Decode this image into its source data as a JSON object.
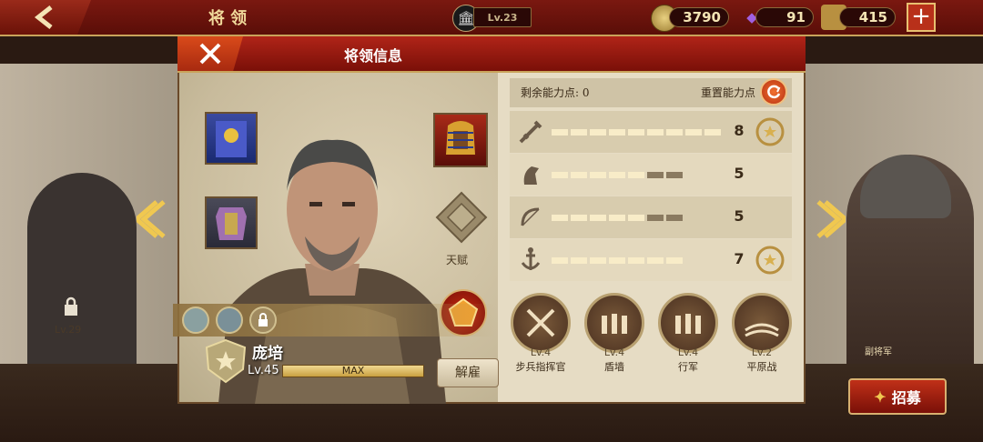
{
  "header": {
    "title": "将 领",
    "hall_level": "Lv.23",
    "resources": {
      "coins": "3790",
      "gems": "91",
      "food": "415"
    }
  },
  "dialog": {
    "title": "将领信息",
    "remaining_points_label": "剩余能力点: 0",
    "reset_label": "重置能力点",
    "talent_label": "天赋",
    "dismiss_label": "解雇",
    "general": {
      "name": "庞培",
      "level": "Lv.45",
      "xp_text": "MAX",
      "xp_fraction": 1.0
    },
    "stats": [
      {
        "icon": "sword-icon",
        "value": "8",
        "fill_segments": 9,
        "total_segments": 9,
        "has_laurel": true
      },
      {
        "icon": "horse-icon",
        "value": "5",
        "fill_segments": 5,
        "total_segments": 7,
        "has_laurel": false
      },
      {
        "icon": "bow-icon",
        "value": "5",
        "fill_segments": 5,
        "total_segments": 7,
        "has_laurel": false
      },
      {
        "icon": "anchor-icon",
        "value": "7",
        "fill_segments": 7,
        "total_segments": 7,
        "has_laurel": true
      }
    ],
    "skills": [
      {
        "level": "Lv.4",
        "name": "步兵指挥官",
        "icon": "crossed-swords-icon"
      },
      {
        "level": "Lv.4",
        "name": "盾墙",
        "icon": "shield-wall-icon"
      },
      {
        "level": "Lv.4",
        "name": "行军",
        "icon": "march-icon"
      },
      {
        "level": "Lv.2",
        "name": "平原战",
        "icon": "plains-icon"
      }
    ]
  },
  "side": {
    "left_level": "Lv.29",
    "right_label": "副将军"
  },
  "recruit_label": "招募",
  "colors": {
    "accent_red": "#b02418",
    "gold": "#c9a35a",
    "parchment": "#e6dcc4"
  }
}
